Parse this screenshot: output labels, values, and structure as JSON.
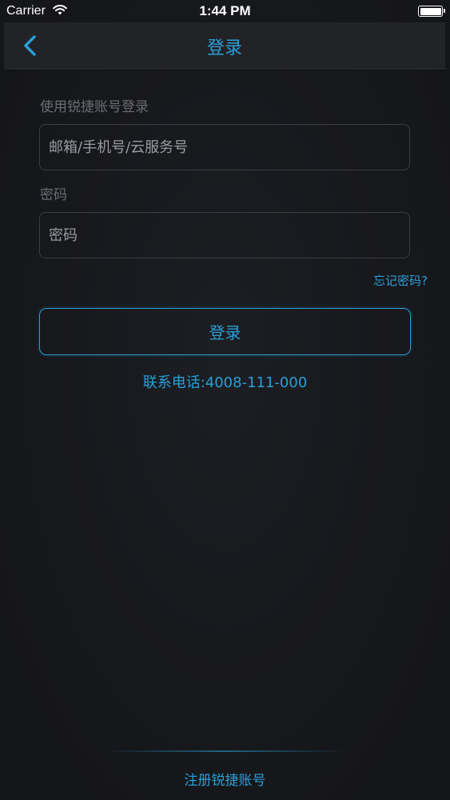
{
  "status_bar": {
    "carrier": "Carrier",
    "time": "1:44 PM",
    "wifi_icon": "wifi-icon",
    "battery_icon": "battery-full-icon"
  },
  "nav": {
    "back_icon": "chevron-left-icon",
    "title": "登录"
  },
  "form": {
    "account_label": "使用锐捷账号登录",
    "account_placeholder": "邮箱/手机号/云服务号",
    "account_value": "",
    "password_label": "密码",
    "password_placeholder": "密码",
    "password_value": "",
    "forgot_password": "忘记密码?",
    "login_button": "登录"
  },
  "contact": {
    "phone": "联系电话:4008-111-000"
  },
  "footer": {
    "register": "注册锐捷账号"
  },
  "colors": {
    "accent": "#2a9fd8",
    "background": "#17181c",
    "nav_background": "#222327",
    "muted_text": "#6b6d73"
  }
}
